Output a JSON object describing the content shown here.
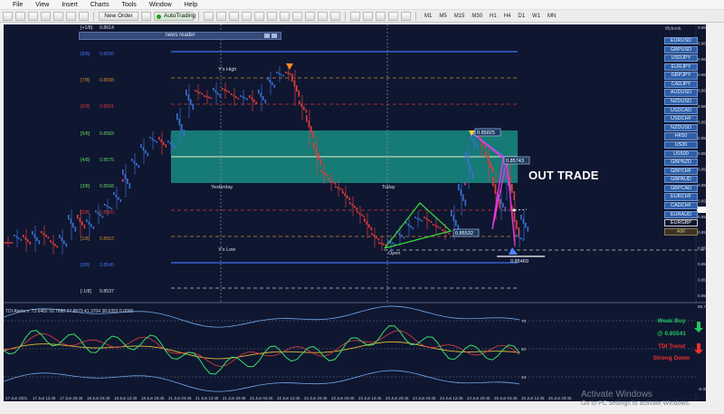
{
  "menu": [
    "File",
    "View",
    "Insert",
    "Charts",
    "Tools",
    "Window",
    "Help"
  ],
  "toolbar": {
    "new_order": "New Order",
    "auto_trading": "AutoTrading",
    "timeframes": [
      "M1",
      "M5",
      "M15",
      "M30",
      "H1",
      "H4",
      "D1",
      "W1",
      "MN"
    ]
  },
  "news_reader": {
    "label": "news reader"
  },
  "mybook": "Mybook",
  "symbols": [
    "EURUSD",
    "GBPUSD",
    "USDJPY",
    "EURJPY",
    "GBPJPY",
    "CADJPY",
    "AUDUSD",
    "NZDUSD",
    "USDCAD",
    "USDCHF",
    "NZDUSD",
    "HK50",
    "US30",
    "US500",
    "GBPNZD",
    "GBPCHF",
    "GBPAUD",
    "GBPCAD",
    "EURCHF",
    "CADCHF",
    "EURAUD",
    "EURGBP",
    "AIR"
  ],
  "murrey_levels": [
    {
      "label": "[+1/8]",
      "value": "0.8614"
    },
    {
      "label": "[8/8]",
      "value": "0.8606"
    },
    {
      "label": "[7/8]",
      "value": "0.8598"
    },
    {
      "label": "[6/8]",
      "value": "0.8591"
    },
    {
      "label": "[5/8]",
      "value": "0.8583"
    },
    {
      "label": "[4/8]",
      "value": "0.8575"
    },
    {
      "label": "[3/8]",
      "value": "0.8568"
    },
    {
      "label": "[2/8]",
      "value": "0.8560"
    },
    {
      "label": "[1/8]",
      "value": "0.8553"
    },
    {
      "label": "[0/8]",
      "value": "0.8545"
    },
    {
      "label": "[-1/8]",
      "value": "0.8537"
    }
  ],
  "chart_labels": {
    "ys_high": "Y's High",
    "ys_low": "Y's Low",
    "yesterday": "Yesterday",
    "today": "Today",
    "open": "Open",
    "out_trade": "OUT TRADE"
  },
  "price_boxes": {
    "top": "0.85825",
    "mid": "0.85743",
    "lower": "0.85532",
    "bottom": "0.85469"
  },
  "price_axis": [
    "0.86375",
    "0.86260",
    "0.86195",
    "0.86130",
    "0.86065",
    "0.86000",
    "0.85935",
    "0.85870",
    "0.85820",
    "0.85770",
    "0.85720",
    "0.85670",
    "0.85620",
    "0.85570",
    "0.85520",
    "0.85470",
    "0.85420",
    "0.85375"
  ],
  "current_price": "0.85596",
  "indicator": {
    "title": "TDI Alerts v: 73.6482 50.7680 27.8879 41.3704 38.6353 0.0000",
    "axis": [
      "88.7535",
      "76",
      "50",
      "33",
      "-0.3009"
    ],
    "signal": "Weak Buy",
    "signal_price": "@ 0.85541",
    "trend_label": "TDI Trend",
    "trend_value": "Strong Down"
  },
  "time_axis": [
    "17 Jun 2021",
    "17 Jun 12:45",
    "17 Jun 20:45",
    "18 Jun 04:45",
    "18 Jun 12:45",
    "18 Jun 20:45",
    "21 Jun 04:45",
    "21 Jun 12:45",
    "21 Jun 20:45",
    "22 Jun 04:45",
    "22 Jun 12:45",
    "22 Jun 20:45",
    "23 Jun 04:45",
    "23 Jun 12:45",
    "23 Jun 20:45",
    "24 Jun 04:45",
    "24 Jun 12:45",
    "24 Jun 20:45",
    "25 Jun 04:45",
    "25 Jun 12:45",
    "25 Jun 20:45"
  ],
  "activate_windows": {
    "title": "Activate Windows",
    "subtitle": "Go to PC settings to activate Windows."
  },
  "colors": {
    "chart_bg": "#0f1630",
    "bull_candle": "#3a6fd1",
    "bear_candle": "#e23b3b",
    "teal_zone": "#1a9c8c",
    "signal_green": "#22c55e",
    "signal_red": "#ef2f2f"
  }
}
